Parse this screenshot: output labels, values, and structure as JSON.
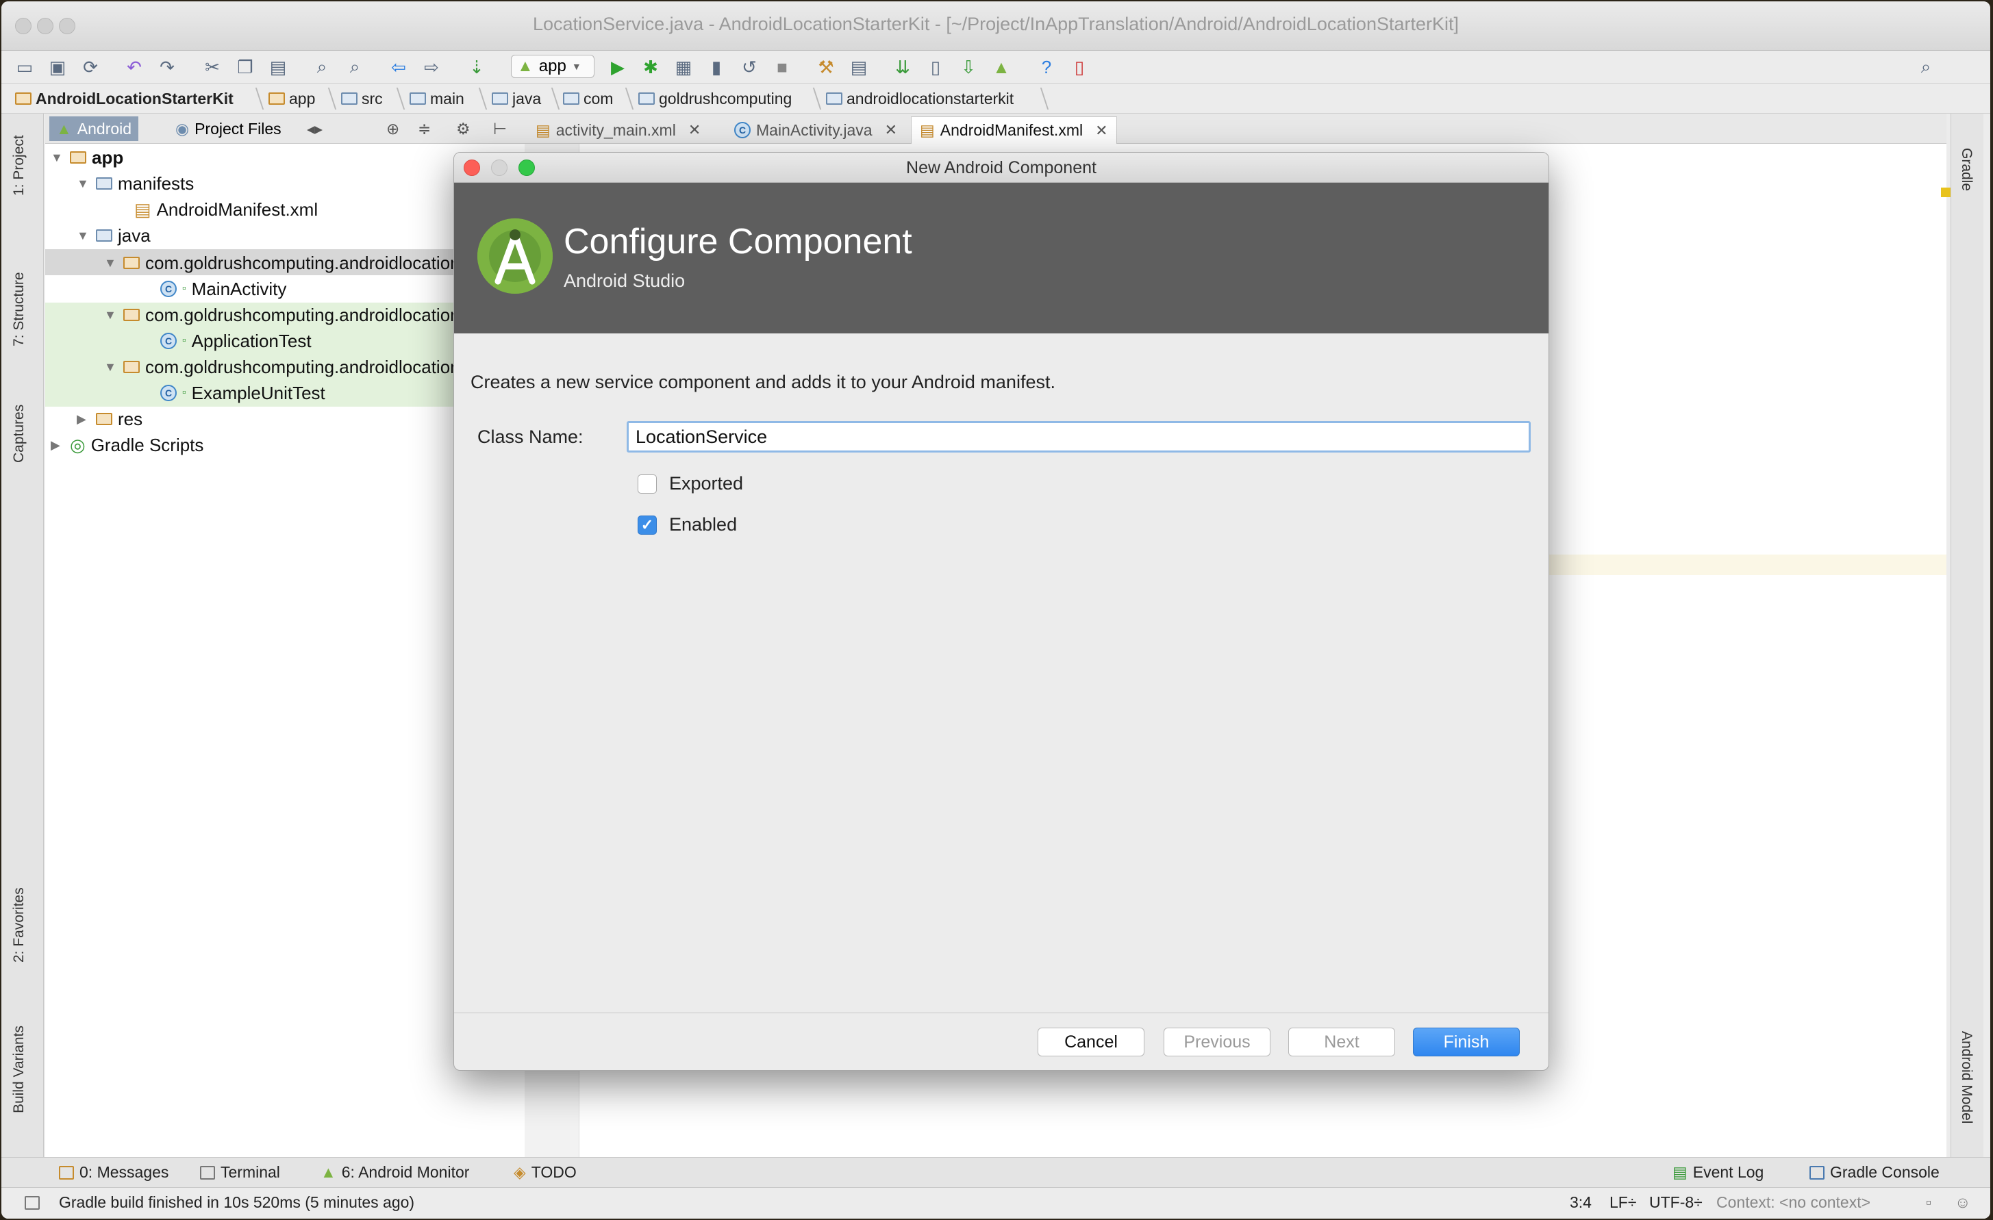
{
  "window": {
    "title": "LocationService.java - AndroidLocationStarterKit - [~/Project/InAppTranslation/Android/AndroidLocationStarterKit]"
  },
  "toolbar": {
    "config": "app"
  },
  "breadcrumbs": [
    "AndroidLocationStarterKit",
    "app",
    "src",
    "main",
    "java",
    "com",
    "goldrushcomputing",
    "androidlocationstarterkit"
  ],
  "sidebar": {
    "left_tabs": [
      "1: Project",
      "7: Structure",
      "Captures",
      "2: Favorites",
      "Build Variants"
    ],
    "right_tabs": [
      "Gradle",
      "Android Model"
    ]
  },
  "project_panel": {
    "tabs": [
      "Android",
      "Project Files"
    ],
    "tree": [
      {
        "label": "app"
      },
      {
        "label": "manifests"
      },
      {
        "label": "AndroidManifest.xml"
      },
      {
        "label": "java"
      },
      {
        "label": "com.goldrushcomputing.androidlocationstarterkit"
      },
      {
        "label": "MainActivity"
      },
      {
        "label": "com.goldrushcomputing.androidlocationstarterkit"
      },
      {
        "label": "ApplicationTest"
      },
      {
        "label": "com.goldrushcomputing.androidlocationstarterkit"
      },
      {
        "label": "ExampleUnitTest"
      },
      {
        "label": "res"
      },
      {
        "label": "Gradle Scripts"
      }
    ]
  },
  "editor_tabs": [
    {
      "label": "activity_main.xml"
    },
    {
      "label": "MainActivity.java"
    },
    {
      "label": "AndroidManifest.xml"
    }
  ],
  "dialog": {
    "window_title": "New Android Component",
    "header_title": "Configure Component",
    "header_subtitle": "Android Studio",
    "description": "Creates a new service component and adds it to your Android manifest.",
    "class_name_label": "Class Name:",
    "class_name_value": "LocationService",
    "exported_label": "Exported",
    "exported_checked": false,
    "enabled_label": "Enabled",
    "enabled_checked": true,
    "buttons": {
      "cancel": "Cancel",
      "previous": "Previous",
      "next": "Next",
      "finish": "Finish"
    },
    "accent_color": "#2f86ef"
  },
  "bottom_tools": [
    {
      "label": "0: Messages"
    },
    {
      "label": "Terminal"
    },
    {
      "label": "6: Android Monitor"
    },
    {
      "label": "TODO"
    },
    {
      "label": "Event Log"
    },
    {
      "label": "Gradle Console"
    }
  ],
  "status": {
    "message": "Gradle build finished in 10s 520ms (5 minutes ago)",
    "position": "3:4",
    "line_sep": "LF÷",
    "encoding": "UTF-8÷",
    "context": "Context: <no context>"
  }
}
